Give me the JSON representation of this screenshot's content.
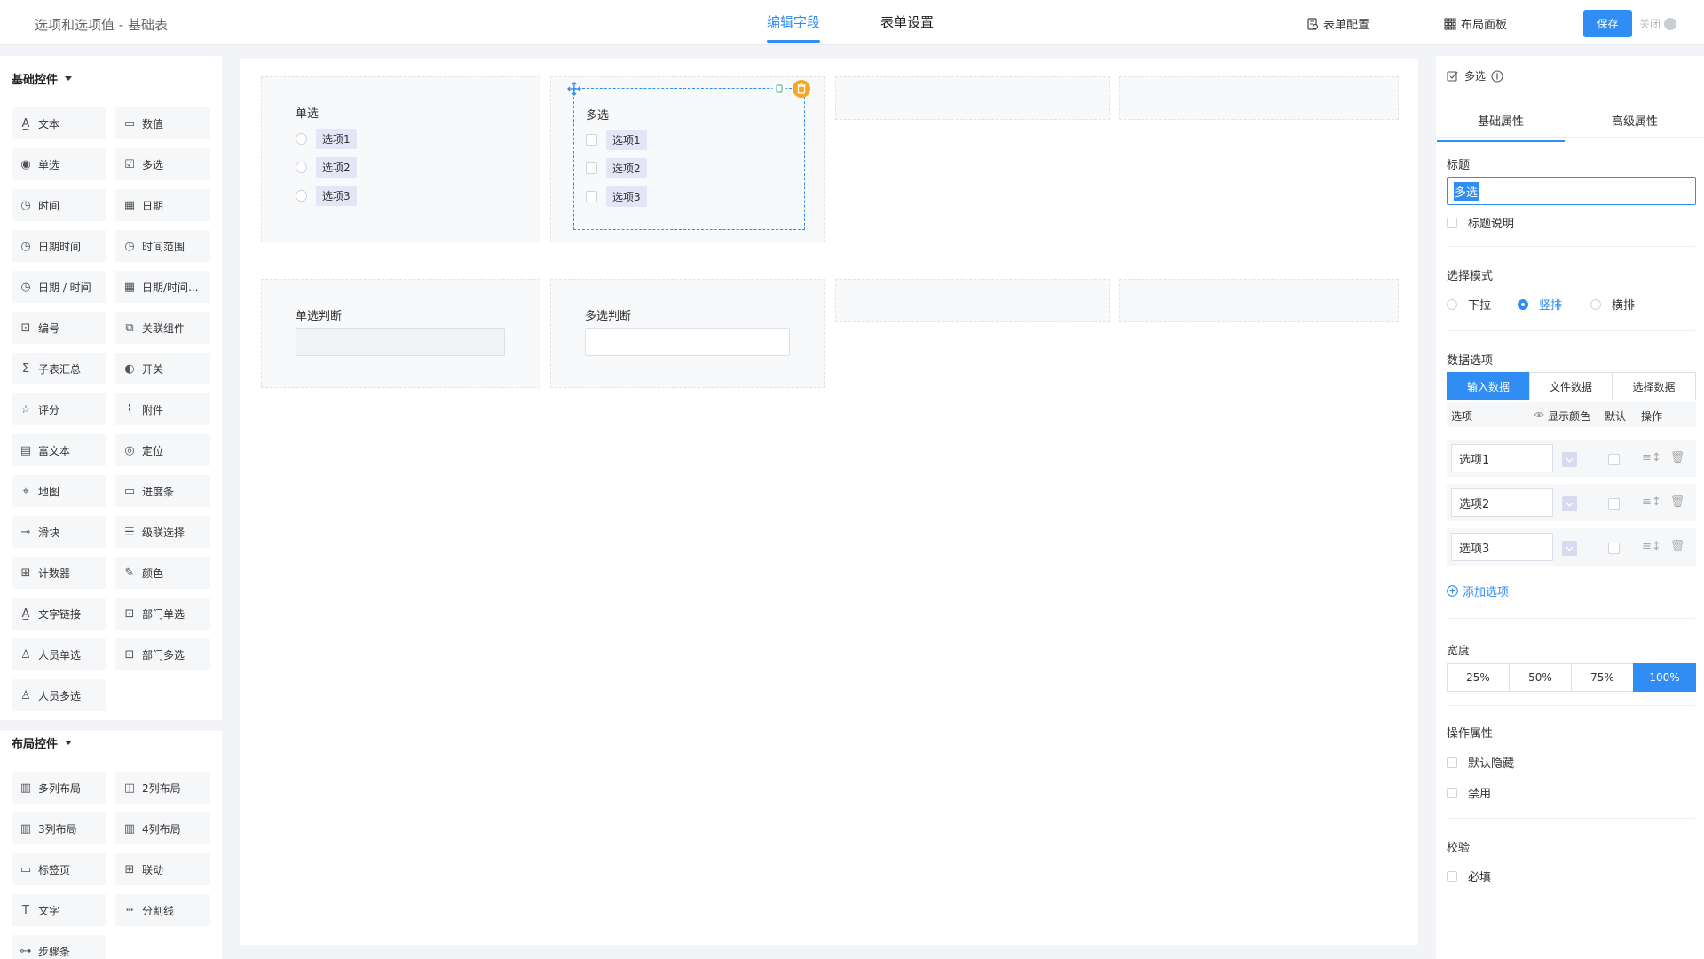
{
  "header": {
    "title": "选项和选项值 - 基础表",
    "tabs": [
      {
        "label": "编辑字段",
        "active": true
      },
      {
        "label": "表单设置",
        "active": false
      }
    ],
    "actions": {
      "form_config": "表单配置",
      "layout_panel": "布局面板",
      "save": "保存",
      "close": "关闭"
    }
  },
  "left_panel": {
    "basic_group": "基础控件",
    "basic_controls": [
      {
        "label": "文本",
        "icon": "text-icon"
      },
      {
        "label": "数值",
        "icon": "number-icon"
      },
      {
        "label": "单选",
        "icon": "radio-icon"
      },
      {
        "label": "多选",
        "icon": "checkbox-icon"
      },
      {
        "label": "时间",
        "icon": "clock-icon"
      },
      {
        "label": "日期",
        "icon": "calendar-icon"
      },
      {
        "label": "日期时间",
        "icon": "clock-icon"
      },
      {
        "label": "时间范围",
        "icon": "clock-icon"
      },
      {
        "label": "日期 / 时间",
        "icon": "clock-icon"
      },
      {
        "label": "日期/时间...",
        "icon": "calendar-icon"
      },
      {
        "label": "编号",
        "icon": "serial-icon"
      },
      {
        "label": "关联组件",
        "icon": "link-component-icon"
      },
      {
        "label": "子表汇总",
        "icon": "sigma-icon"
      },
      {
        "label": "开关",
        "icon": "toggle-icon"
      },
      {
        "label": "评分",
        "icon": "star-icon"
      },
      {
        "label": "附件",
        "icon": "paperclip-icon"
      },
      {
        "label": "富文本",
        "icon": "rich-text-icon"
      },
      {
        "label": "定位",
        "icon": "location-icon"
      },
      {
        "label": "地图",
        "icon": "map-icon"
      },
      {
        "label": "进度条",
        "icon": "progress-icon"
      },
      {
        "label": "滑块",
        "icon": "slider-icon"
      },
      {
        "label": "级联选择",
        "icon": "cascade-icon"
      },
      {
        "label": "计数器",
        "icon": "counter-icon"
      },
      {
        "label": "颜色",
        "icon": "color-picker-icon"
      },
      {
        "label": "文字链接",
        "icon": "text-link-icon"
      },
      {
        "label": "部门单选",
        "icon": "department-icon"
      },
      {
        "label": "人员单选",
        "icon": "user-icon"
      },
      {
        "label": "部门多选",
        "icon": "department-multi-icon"
      },
      {
        "label": "人员多选",
        "icon": "users-icon"
      }
    ],
    "layout_group": "布局控件",
    "layout_controls": [
      {
        "label": "多列布局",
        "icon": "multi-column-icon"
      },
      {
        "label": "2列布局",
        "icon": "two-column-icon"
      },
      {
        "label": "3列布局",
        "icon": "three-column-icon"
      },
      {
        "label": "4列布局",
        "icon": "four-column-icon"
      },
      {
        "label": "标签页",
        "icon": "tabs-icon"
      },
      {
        "label": "联动",
        "icon": "linkage-icon"
      },
      {
        "label": "文字",
        "icon": "text-t-icon"
      },
      {
        "label": "分割线",
        "icon": "divider-icon"
      },
      {
        "label": "步骤条",
        "icon": "steps-icon"
      }
    ]
  },
  "canvas": {
    "single_select": {
      "label": "单选",
      "options": [
        "选项1",
        "选项2",
        "选项3"
      ]
    },
    "multi_select": {
      "label": "多选",
      "options": [
        "选项1",
        "选项2",
        "选项3"
      ]
    },
    "single_judge": {
      "label": "单选判断"
    },
    "multi_judge": {
      "label": "多选判断"
    }
  },
  "right_panel": {
    "header": "多选",
    "tabs": [
      "基础属性",
      "高级属性"
    ],
    "title_section": "标题",
    "title_value": "多选",
    "title_desc": "标题说明",
    "select_mode": {
      "title": "选择模式",
      "options": [
        "下拉",
        "竖排",
        "横排"
      ],
      "selected": "竖排"
    },
    "data_options": {
      "title": "数据选项",
      "sources": [
        "输入数据",
        "文件数据",
        "选择数据"
      ],
      "active_source": "输入数据",
      "columns": {
        "option": "选项",
        "show_color": "显示颜色",
        "default": "默认",
        "ops": "操作"
      },
      "items": [
        "选项1",
        "选项2",
        "选项3"
      ],
      "add": "添加选项"
    },
    "width": {
      "title": "宽度",
      "options": [
        "25%",
        "50%",
        "75%",
        "100%"
      ],
      "selected": "100%"
    },
    "operation": {
      "title": "操作属性",
      "items": [
        "默认隐藏",
        "禁用"
      ]
    },
    "validation": {
      "title": "校验",
      "items": [
        "必填"
      ]
    }
  },
  "colors": {
    "accent": "#2f8df4",
    "chip": "#e4e6f7",
    "delete": "#f5a623"
  }
}
